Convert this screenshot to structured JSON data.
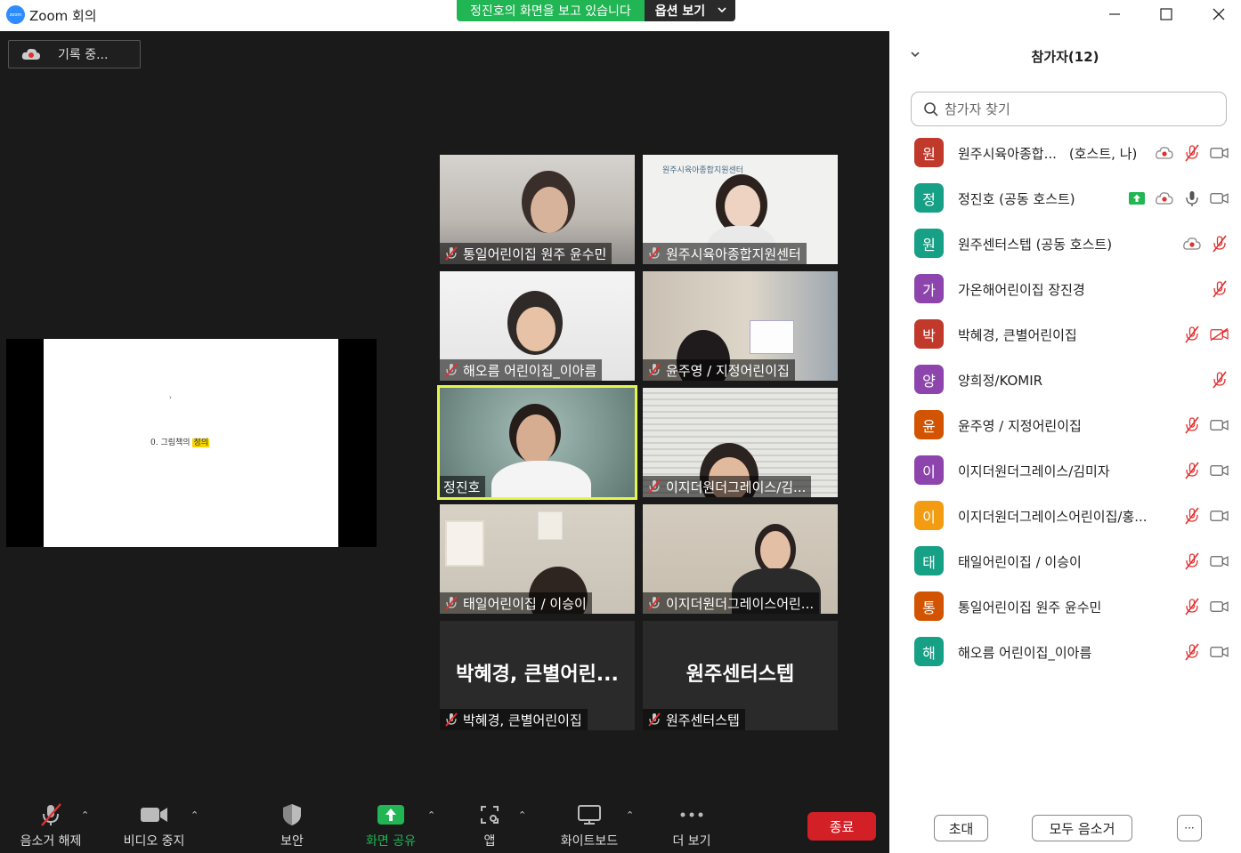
{
  "window": {
    "logo_text": "zoom",
    "title": "Zoom 회의"
  },
  "share_banner": {
    "message": "정진호의 화면을 보고 있습니다",
    "options_label": "옵션 보기"
  },
  "recording": {
    "label": "기록 중..."
  },
  "shared_screen": {
    "dot": "›",
    "text_prefix": "0. 그림책의 ",
    "text_highlight": "정의"
  },
  "tiles": [
    {
      "name": "통일어린이집 원주 윤수민",
      "muted": true,
      "kind": "video"
    },
    {
      "name": "원주시육아종합지원센터",
      "muted": true,
      "kind": "video",
      "logo_text": "원주시육아종합지원센터"
    },
    {
      "name": "해오름 어린이집_이아름",
      "muted": true,
      "kind": "video"
    },
    {
      "name": "윤주영 / 지정어린이집",
      "muted": true,
      "kind": "video"
    },
    {
      "name": "정진호",
      "muted": false,
      "kind": "video",
      "active": true
    },
    {
      "name": "이지더원더그레이스/김...",
      "muted": true,
      "kind": "video"
    },
    {
      "name": "태일어린이집 / 이승이",
      "muted": true,
      "kind": "video"
    },
    {
      "name": "이지더원더그레이스어린...",
      "muted": true,
      "kind": "video"
    },
    {
      "name": "박혜경, 큰별어린이집",
      "muted": true,
      "kind": "off",
      "big_name": "박혜경, 큰별어린..."
    },
    {
      "name": "원주센터스텝",
      "muted": true,
      "kind": "off",
      "big_name": "원주센터스텝"
    }
  ],
  "toolbar": {
    "unmute": "음소거 해제",
    "stop_video": "비디오 중지",
    "security": "보안",
    "share_screen": "화면 공유",
    "apps": "앱",
    "whiteboard": "화이트보드",
    "more": "더 보기",
    "end": "종료"
  },
  "panel": {
    "title": "참가자(12)",
    "search_placeholder": "참가자 찾기",
    "invite": "초대",
    "mute_all": "모두 음소거",
    "more": "···"
  },
  "participants": [
    {
      "initial": "원",
      "color": "#c0392b",
      "name": "원주시육아종합...",
      "tag": "(호스트, 나)",
      "icons": [
        "record",
        "mic-off",
        "video"
      ]
    },
    {
      "initial": "정",
      "color": "#16a085",
      "name": "정진호 (공동 호스트)",
      "tag": "",
      "icons": [
        "share",
        "record",
        "mic",
        "video"
      ]
    },
    {
      "initial": "원",
      "color": "#16a085",
      "name": "원주센터스텝 (공동 호스트)",
      "tag": "",
      "icons": [
        "record",
        "mic-off"
      ]
    },
    {
      "initial": "가",
      "color": "#8e44ad",
      "name": "가온해어린이집 장진경",
      "tag": "",
      "icons": [
        "mic-off"
      ]
    },
    {
      "initial": "박",
      "color": "#c0392b",
      "name": "박혜경, 큰별어린이집",
      "tag": "",
      "icons": [
        "mic-off",
        "video-off"
      ]
    },
    {
      "initial": "양",
      "color": "#8e44ad",
      "name": "양희정/KOMIR",
      "tag": "",
      "icons": [
        "mic-off"
      ]
    },
    {
      "initial": "윤",
      "color": "#d35400",
      "name": "윤주영 / 지정어린이집",
      "tag": "",
      "icons": [
        "mic-off",
        "video"
      ]
    },
    {
      "initial": "이",
      "color": "#8e44ad",
      "name": "이지더원더그레이스/김미자",
      "tag": "",
      "icons": [
        "mic-off",
        "video"
      ]
    },
    {
      "initial": "이",
      "color": "#f39c12",
      "name": "이지더원더그레이스어린이집/홍...",
      "tag": "",
      "icons": [
        "mic-off",
        "video"
      ]
    },
    {
      "initial": "태",
      "color": "#16a085",
      "name": "태일어린이집 / 이승이",
      "tag": "",
      "icons": [
        "mic-off",
        "video"
      ]
    },
    {
      "initial": "통",
      "color": "#d35400",
      "name": "통일어린이집 원주 윤수민",
      "tag": "",
      "icons": [
        "mic-off",
        "video"
      ]
    },
    {
      "initial": "해",
      "color": "#16a085",
      "name": "해오름 어린이집_이아름",
      "tag": "",
      "icons": [
        "mic-off",
        "video"
      ]
    }
  ]
}
